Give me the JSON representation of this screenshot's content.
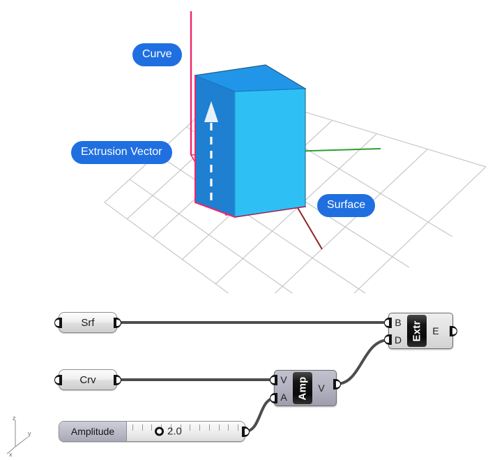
{
  "viewport": {
    "labels": [
      {
        "id": "curve",
        "text": "Curve"
      },
      {
        "id": "vector",
        "text": "Extrusion Vector"
      },
      {
        "id": "surface",
        "text": "Surface"
      }
    ],
    "axis_gizmo": {
      "z": "z",
      "y": "y",
      "x": "x"
    },
    "colors": {
      "label_pill": "#1f6fe0",
      "box_top": "#2196e8",
      "box_left": "#1f7fd0",
      "box_front": "#2ec0f5",
      "curve_outline": "#f0256a",
      "axis_z": "#f0256a",
      "axis_y": "#2f9e2f",
      "axis_x": "#8e2323",
      "grid": "#b9b9b9",
      "vector_arrow": "#ffffff"
    }
  },
  "graph": {
    "params": [
      {
        "id": "srf",
        "label": "Srf"
      },
      {
        "id": "crv",
        "label": "Crv"
      }
    ],
    "components": [
      {
        "id": "extrude",
        "nucleus": "Extr",
        "inputs": [
          "B",
          "D"
        ],
        "outputs": [
          "E"
        ],
        "style": "grey"
      },
      {
        "id": "amplitude",
        "nucleus": "Amp",
        "inputs": [
          "V",
          "A"
        ],
        "outputs": [
          "V"
        ],
        "style": "slate"
      }
    ],
    "slider": {
      "id": "amplitude-slider",
      "name": "Amplitude",
      "value": "2.0",
      "tick_count": 12
    },
    "wires": [
      {
        "from": "srf",
        "to": "extrude.B"
      },
      {
        "from": "crv",
        "to": "amplitude.V"
      },
      {
        "from": "amplitude-slider",
        "to": "amplitude.A"
      },
      {
        "from": "amplitude.V",
        "to": "extrude.D"
      }
    ],
    "colors": {
      "wire": "#4d4d4d",
      "nub": "#141414"
    }
  }
}
